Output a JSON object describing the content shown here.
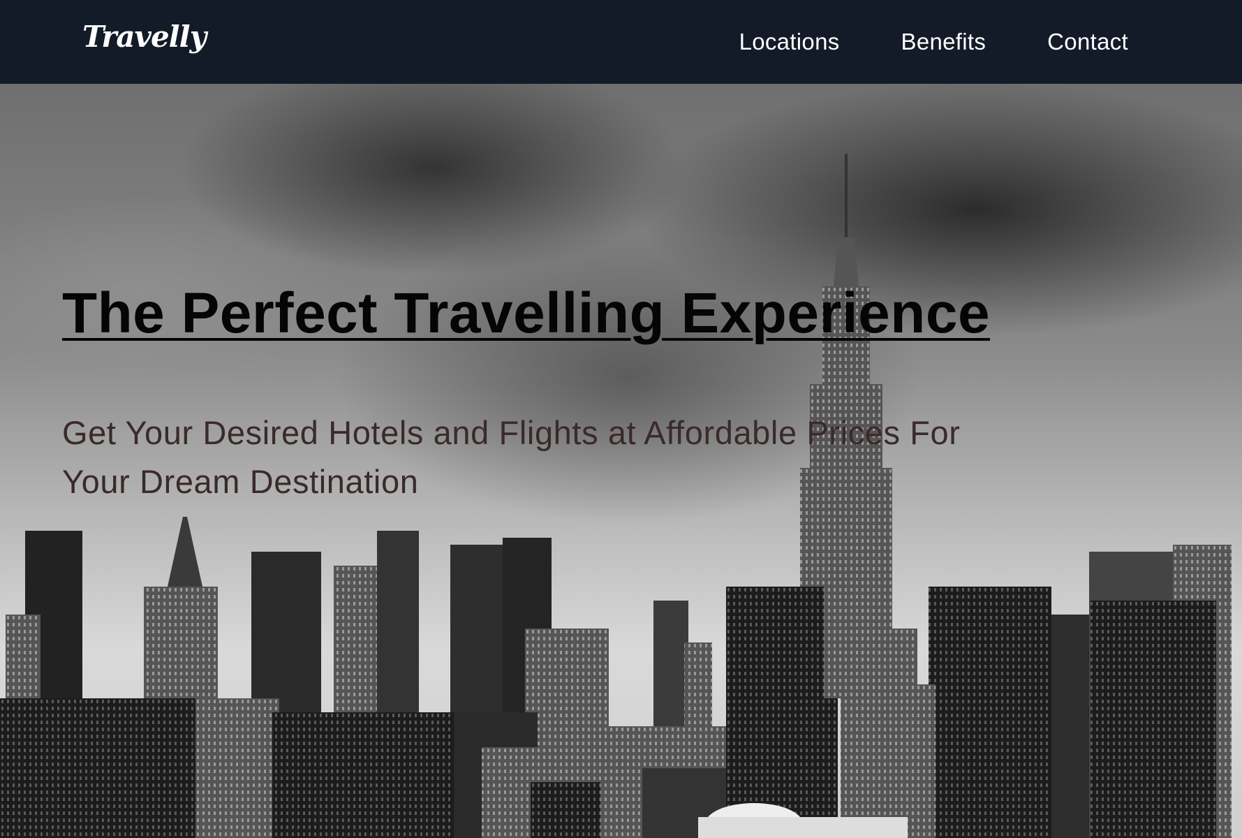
{
  "navbar": {
    "logo": "Travelly",
    "links": [
      {
        "label": "Locations"
      },
      {
        "label": "Benefits"
      },
      {
        "label": "Contact"
      }
    ]
  },
  "hero": {
    "title": "The Perfect Travelling Experience",
    "subtitle": "Get Your Desired Hotels and Flights at Affordable Prices For Your Dream Destination",
    "background_image": "black-and-white city skyline with skyscrapers under a cloudy sky"
  },
  "colors": {
    "navbar_bg": "#131b28",
    "nav_text": "#ffffff",
    "title_text": "#050505",
    "subtitle_text": "#3a2a2a"
  }
}
